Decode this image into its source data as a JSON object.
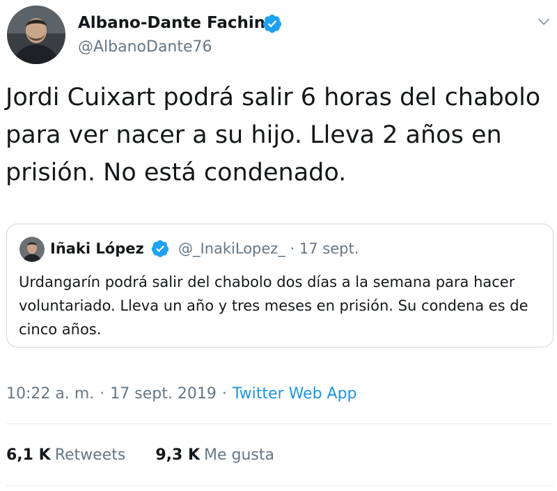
{
  "author": {
    "name": "Albano-Dante Fachin",
    "handle": "@AlbanoDante76",
    "verified": true
  },
  "tweet": {
    "text": "Jordi Cuixart podrá salir 6 horas del chabolo para ver nacer a su hijo. Lleva 2 años en prisión. No está condenado."
  },
  "quoted_tweet": {
    "name": "Iñaki López",
    "handle": "@_InakiLopez_",
    "separator": "·",
    "date": "17 sept.",
    "verified": true,
    "text": "Urdangarín podrá salir del chabolo dos días a la semana para hacer voluntariado. Lleva un año y tres meses en prisión. Su condena es de cinco años."
  },
  "meta": {
    "time": "10:22 a. m.",
    "separator": "·",
    "date": "17 sept. 2019",
    "source": "Twitter Web App"
  },
  "stats": {
    "retweets_count": "6,1 K",
    "retweets_label": "Retweets",
    "likes_count": "9,3 K",
    "likes_label": "Me gusta"
  },
  "colors": {
    "verified_blue": "#1da1f2",
    "link_blue": "#1b95e0",
    "secondary_text": "#657786",
    "border": "#ccd6dd"
  },
  "icons": {
    "verified": "verified-badge-icon",
    "menu": "chevron-down-icon"
  }
}
